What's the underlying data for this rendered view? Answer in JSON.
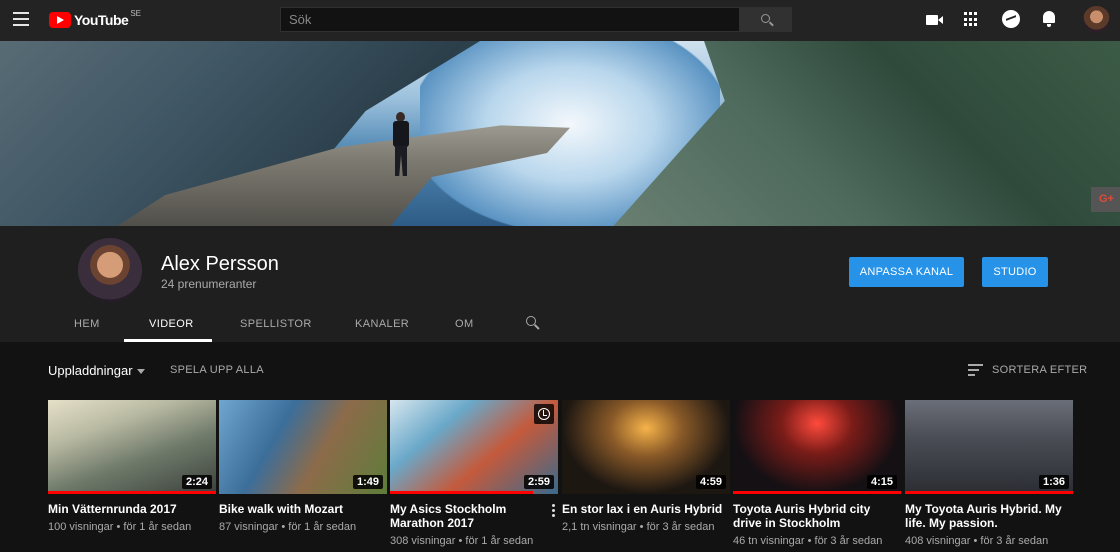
{
  "header": {
    "logo_text": "YouTube",
    "logo_country": "SE",
    "search_placeholder": "Sök",
    "icons": [
      "menu-icon",
      "search-icon",
      "create-video-icon",
      "apps-icon",
      "messages-icon",
      "notifications-icon",
      "account-avatar"
    ]
  },
  "channel": {
    "name": "Alex Persson",
    "subscribers": "24 prenumeranter",
    "customize_label": "ANPASSA KANAL",
    "studio_label": "STUDIO",
    "accent": "#2793e8"
  },
  "tabs": [
    {
      "label": "HEM"
    },
    {
      "label": "VIDEOR"
    },
    {
      "label": "SPELLISTOR"
    },
    {
      "label": "KANALER"
    },
    {
      "label": "OM"
    }
  ],
  "active_tab": "VIDEOR",
  "content": {
    "section_label": "Uppladdningar",
    "play_all_label": "SPELA UPP ALLA",
    "sort_label": "SORTERA EFTER"
  },
  "videos": [
    {
      "title": "Min Vätternrunda 2017",
      "meta": "100 visningar • för 1 år sedan",
      "duration": "2:24",
      "watched": 1.0
    },
    {
      "title": "Bike walk with Mozart",
      "meta": "87 visningar • för 1 år sedan",
      "duration": "1:49",
      "watched": 0.0
    },
    {
      "title": "My Asics Stockholm Marathon 2017",
      "meta": "308 visningar • för 1 år sedan",
      "duration": "2:59",
      "watched": 0.85
    },
    {
      "title": "En stor lax i en Auris Hybrid",
      "meta": "2,1 tn visningar • för 3 år sedan",
      "duration": "4:59",
      "watched": 0.0
    },
    {
      "title": "Toyota Auris Hybrid city drive in Stockholm",
      "meta": "46 tn visningar • för 3 år sedan",
      "duration": "4:15",
      "watched": 1.0
    },
    {
      "title": "My Toyota Auris Hybrid. My life. My passion.",
      "meta": "408 visningar • för 3 år sedan",
      "duration": "1:36",
      "watched": 1.0
    }
  ]
}
